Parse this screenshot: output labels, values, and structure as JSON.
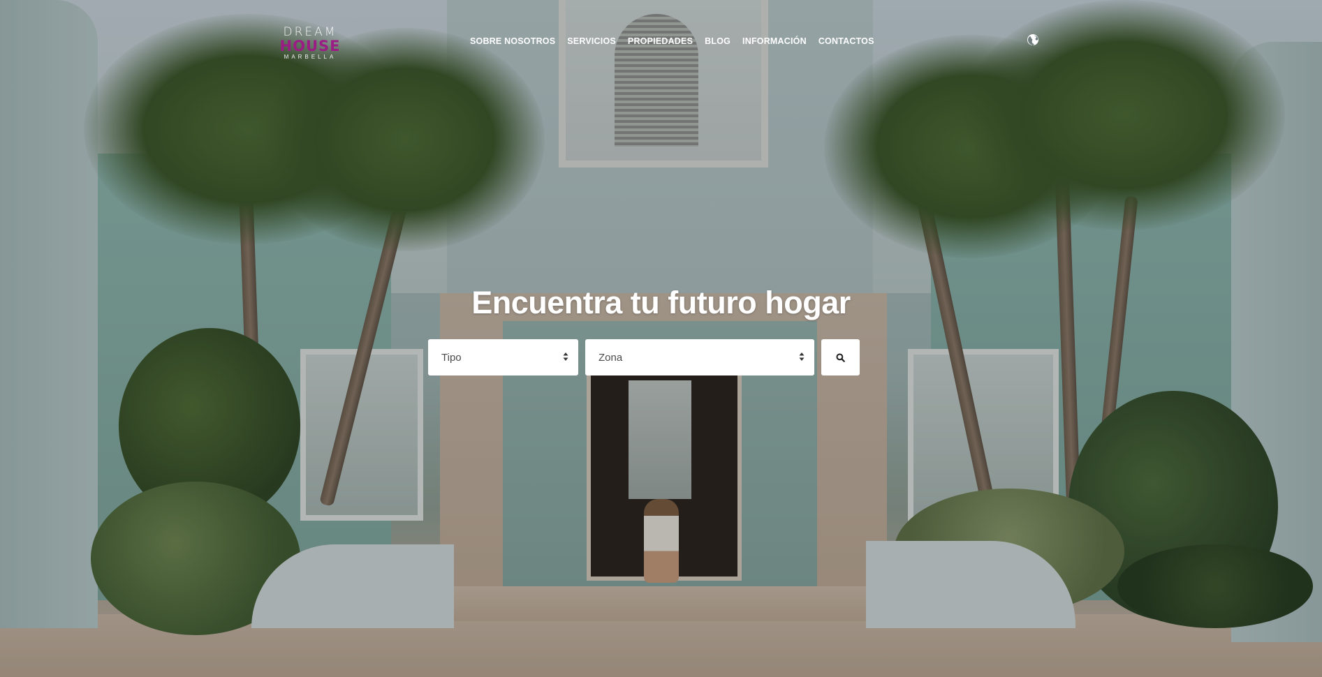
{
  "logo": {
    "line1": "DREAM",
    "line2": "HOUSE",
    "line3": "MARBELLA",
    "accent_color": "#9c1c86"
  },
  "nav": {
    "items": [
      {
        "label": "SOBRE NOSOTROS"
      },
      {
        "label": "SERVICIOS"
      },
      {
        "label": "PROPIEDADES"
      },
      {
        "label": "BLOG"
      },
      {
        "label": "INFORMACIÓN"
      },
      {
        "label": "CONTACTOS"
      }
    ],
    "language_icon": "globe-icon"
  },
  "hero": {
    "headline": "Encuentra tu futuro hogar",
    "search": {
      "tipo_selected": "Tipo",
      "zona_selected": "Zona",
      "button_icon": "search-icon"
    },
    "background_image": "luxury-house-entrance-with-palm-trees"
  }
}
